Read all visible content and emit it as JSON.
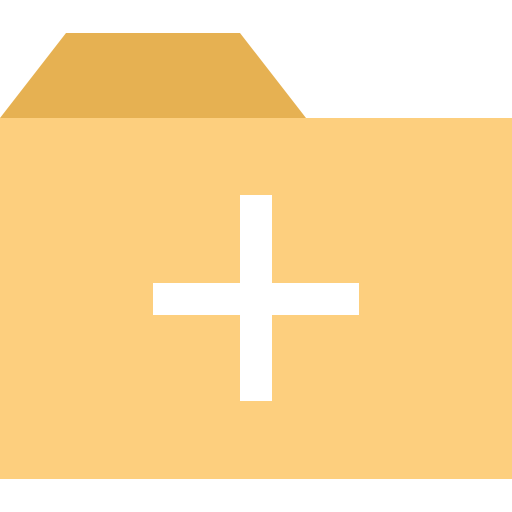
{
  "icon": {
    "name": "new-folder-icon",
    "colors": {
      "tab": "#E6B152",
      "body": "#FDCF7E",
      "plus": "#FFFFFF",
      "background": "#FFFFFF"
    }
  }
}
